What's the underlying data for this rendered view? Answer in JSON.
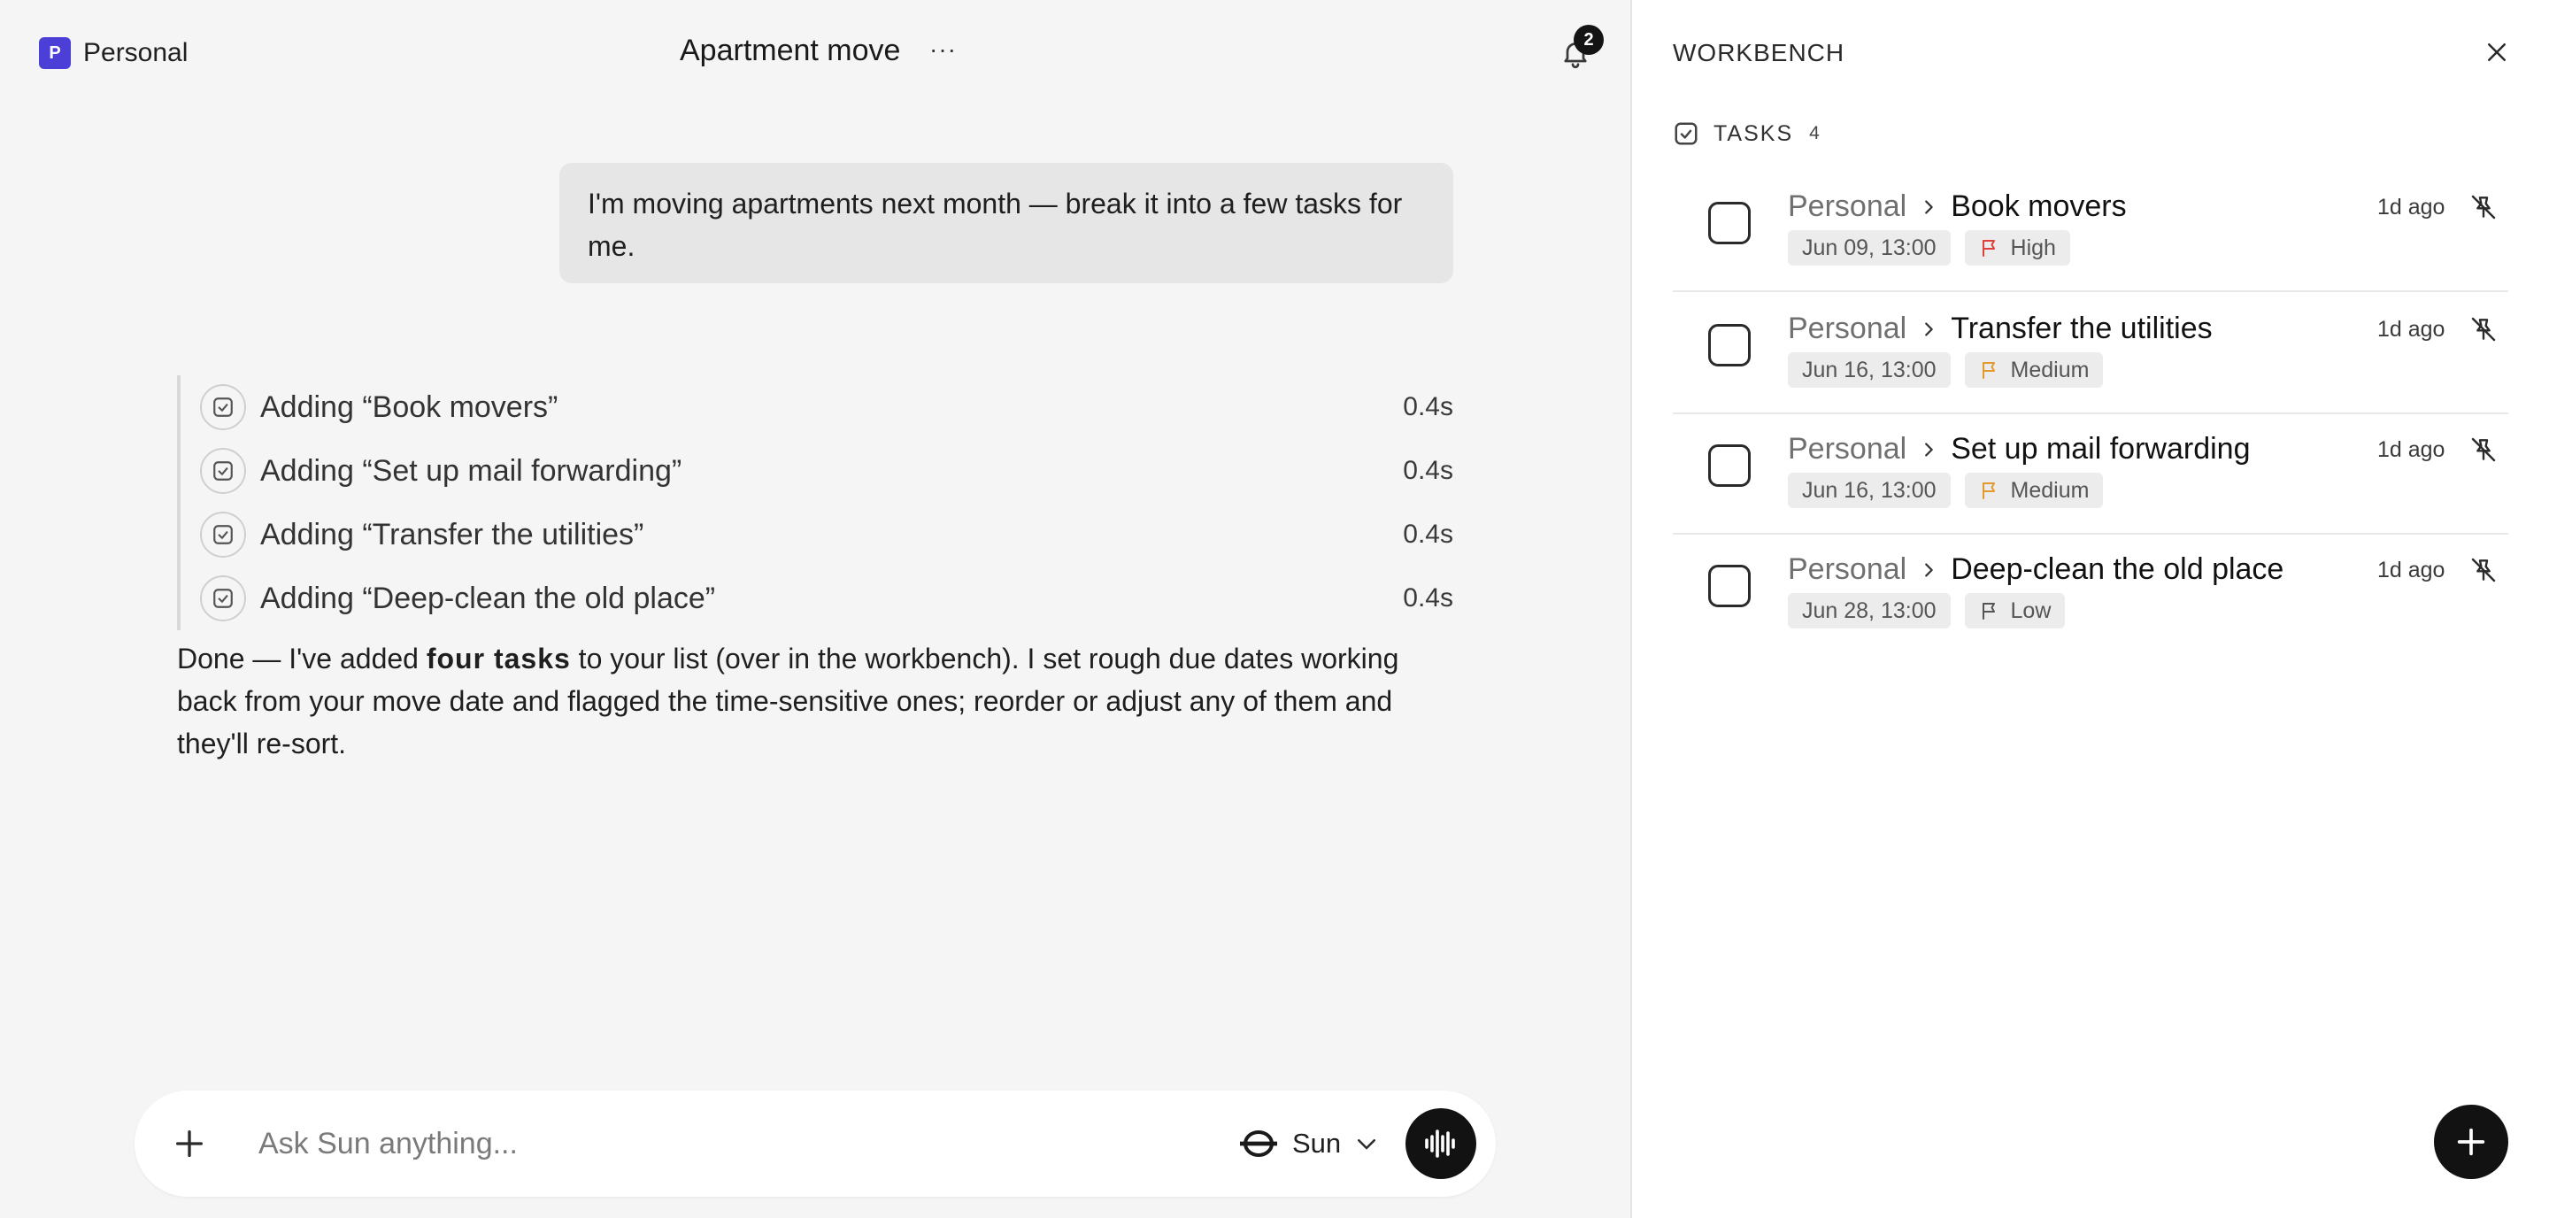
{
  "header": {
    "workspace_initial": "P",
    "workspace_name": "Personal",
    "title": "Apartment move",
    "more_label": "···",
    "notification_count": "2"
  },
  "conversation": {
    "user_message": "I'm moving apartments next month — break it into a few tasks for me.",
    "steps": [
      {
        "label": "Adding “Book movers”",
        "time": "0.4s"
      },
      {
        "label": "Adding “Set up mail forwarding”",
        "time": "0.4s"
      },
      {
        "label": "Adding “Transfer the utilities”",
        "time": "0.4s"
      },
      {
        "label": "Adding “Deep-clean the old place”",
        "time": "0.4s"
      }
    ],
    "reply": {
      "before": "Done — I've added ",
      "bold": "four tasks",
      "after": " to your list (over in the workbench). I set rough due dates working back from your move date and flagged the time-sensitive ones; reorder or adjust any of them and they'll re-sort."
    }
  },
  "composer": {
    "placeholder": "Ask Sun anything...",
    "model_name": "Sun"
  },
  "workbench": {
    "title": "WORKBENCH",
    "tasks_label": "TASKS",
    "tasks_count": "4",
    "tasks": [
      {
        "list": "Personal",
        "name": "Book movers",
        "due": "Jun 09, 13:00",
        "priority": "High",
        "priority_color": "#e0403a",
        "ago": "1d ago"
      },
      {
        "list": "Personal",
        "name": "Transfer the utilities",
        "due": "Jun 16, 13:00",
        "priority": "Medium",
        "priority_color": "#e29a2e",
        "ago": "1d ago"
      },
      {
        "list": "Personal",
        "name": "Set up mail forwarding",
        "due": "Jun 16, 13:00",
        "priority": "Medium",
        "priority_color": "#e29a2e",
        "ago": "1d ago"
      },
      {
        "list": "Personal",
        "name": "Deep-clean the old place",
        "due": "Jun 28, 13:00",
        "priority": "Low",
        "priority_color": "#555555",
        "ago": "1d ago"
      }
    ]
  }
}
